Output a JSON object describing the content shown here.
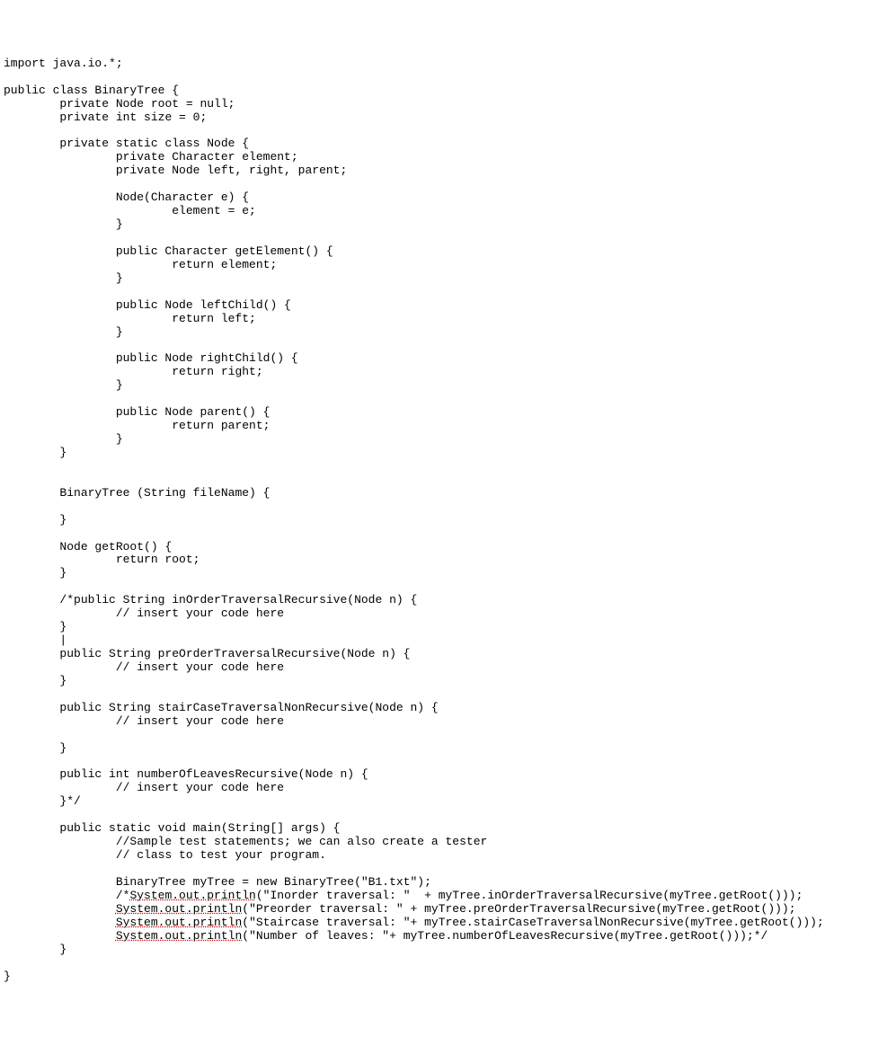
{
  "code_lines": [
    {
      "indent": 0,
      "segments": [
        {
          "t": "import java.io.*;"
        }
      ]
    },
    {
      "indent": 0,
      "segments": [
        {
          "t": ""
        }
      ]
    },
    {
      "indent": 0,
      "segments": [
        {
          "t": "public class BinaryTree {"
        }
      ]
    },
    {
      "indent": 8,
      "segments": [
        {
          "t": "private Node root = null;"
        }
      ]
    },
    {
      "indent": 8,
      "segments": [
        {
          "t": "private int size = 0;"
        }
      ]
    },
    {
      "indent": 0,
      "segments": [
        {
          "t": ""
        }
      ]
    },
    {
      "indent": 8,
      "segments": [
        {
          "t": "private static class Node {"
        }
      ]
    },
    {
      "indent": 16,
      "segments": [
        {
          "t": "private Character element;"
        }
      ]
    },
    {
      "indent": 16,
      "segments": [
        {
          "t": "private Node left, right, parent;"
        }
      ]
    },
    {
      "indent": 0,
      "segments": [
        {
          "t": ""
        }
      ]
    },
    {
      "indent": 16,
      "segments": [
        {
          "t": "Node(Character e) {"
        }
      ]
    },
    {
      "indent": 24,
      "segments": [
        {
          "t": "element = e;"
        }
      ]
    },
    {
      "indent": 16,
      "segments": [
        {
          "t": "}"
        }
      ]
    },
    {
      "indent": 0,
      "segments": [
        {
          "t": ""
        }
      ]
    },
    {
      "indent": 16,
      "segments": [
        {
          "t": "public Character getElement() {"
        }
      ]
    },
    {
      "indent": 24,
      "segments": [
        {
          "t": "return element;"
        }
      ]
    },
    {
      "indent": 16,
      "segments": [
        {
          "t": "}"
        }
      ]
    },
    {
      "indent": 0,
      "segments": [
        {
          "t": ""
        }
      ]
    },
    {
      "indent": 16,
      "segments": [
        {
          "t": "public Node leftChild() {"
        }
      ]
    },
    {
      "indent": 24,
      "segments": [
        {
          "t": "return left;"
        }
      ]
    },
    {
      "indent": 16,
      "segments": [
        {
          "t": "}"
        }
      ]
    },
    {
      "indent": 0,
      "segments": [
        {
          "t": ""
        }
      ]
    },
    {
      "indent": 16,
      "segments": [
        {
          "t": "public Node rightChild() {"
        }
      ]
    },
    {
      "indent": 24,
      "segments": [
        {
          "t": "return right;"
        }
      ]
    },
    {
      "indent": 16,
      "segments": [
        {
          "t": "}"
        }
      ]
    },
    {
      "indent": 0,
      "segments": [
        {
          "t": ""
        }
      ]
    },
    {
      "indent": 16,
      "segments": [
        {
          "t": "public Node parent() {"
        }
      ]
    },
    {
      "indent": 24,
      "segments": [
        {
          "t": "return parent;"
        }
      ]
    },
    {
      "indent": 16,
      "segments": [
        {
          "t": "}"
        }
      ]
    },
    {
      "indent": 8,
      "segments": [
        {
          "t": "}"
        }
      ]
    },
    {
      "indent": 0,
      "segments": [
        {
          "t": ""
        }
      ]
    },
    {
      "indent": 0,
      "segments": [
        {
          "t": ""
        }
      ]
    },
    {
      "indent": 8,
      "segments": [
        {
          "t": "BinaryTree (String fileName) {"
        }
      ]
    },
    {
      "indent": 0,
      "segments": [
        {
          "t": ""
        }
      ]
    },
    {
      "indent": 8,
      "segments": [
        {
          "t": "}"
        }
      ]
    },
    {
      "indent": 0,
      "segments": [
        {
          "t": ""
        }
      ]
    },
    {
      "indent": 8,
      "segments": [
        {
          "t": "Node getRoot() {"
        }
      ]
    },
    {
      "indent": 16,
      "segments": [
        {
          "t": "return root;"
        }
      ]
    },
    {
      "indent": 8,
      "segments": [
        {
          "t": "}"
        }
      ]
    },
    {
      "indent": 0,
      "segments": [
        {
          "t": ""
        }
      ]
    },
    {
      "indent": 8,
      "segments": [
        {
          "t": "/*public String inOrderTraversalRecursive(Node n) {"
        }
      ]
    },
    {
      "indent": 16,
      "segments": [
        {
          "t": "// insert your code here"
        }
      ]
    },
    {
      "indent": 8,
      "segments": [
        {
          "t": "}"
        }
      ]
    },
    {
      "indent": 8,
      "segments": [
        {
          "t": "|"
        }
      ]
    },
    {
      "indent": 8,
      "segments": [
        {
          "t": "public String preOrderTraversalRecursive(Node n) {"
        }
      ]
    },
    {
      "indent": 16,
      "segments": [
        {
          "t": "// insert your code here"
        }
      ]
    },
    {
      "indent": 8,
      "segments": [
        {
          "t": "}"
        }
      ]
    },
    {
      "indent": 0,
      "segments": [
        {
          "t": ""
        }
      ]
    },
    {
      "indent": 8,
      "segments": [
        {
          "t": "public String stairCaseTraversalNonRecursive(Node n) {"
        }
      ]
    },
    {
      "indent": 16,
      "segments": [
        {
          "t": "// insert your code here"
        }
      ]
    },
    {
      "indent": 0,
      "segments": [
        {
          "t": ""
        }
      ]
    },
    {
      "indent": 8,
      "segments": [
        {
          "t": "}"
        }
      ]
    },
    {
      "indent": 0,
      "segments": [
        {
          "t": ""
        }
      ]
    },
    {
      "indent": 8,
      "segments": [
        {
          "t": "public int numberOfLeavesRecursive(Node n) {"
        }
      ]
    },
    {
      "indent": 16,
      "segments": [
        {
          "t": "// insert your code here"
        }
      ]
    },
    {
      "indent": 8,
      "segments": [
        {
          "t": "}*/"
        }
      ]
    },
    {
      "indent": 0,
      "segments": [
        {
          "t": ""
        }
      ]
    },
    {
      "indent": 8,
      "segments": [
        {
          "t": "public static void main(String[] args) {"
        }
      ]
    },
    {
      "indent": 16,
      "segments": [
        {
          "t": "//Sample test statements; we can also create a tester"
        }
      ]
    },
    {
      "indent": 16,
      "segments": [
        {
          "t": "// class to test your program."
        }
      ]
    },
    {
      "indent": 0,
      "segments": [
        {
          "t": ""
        }
      ]
    },
    {
      "indent": 16,
      "segments": [
        {
          "t": "BinaryTree myTree = new BinaryTree(\"B1.txt\");"
        }
      ]
    },
    {
      "indent": 16,
      "segments": [
        {
          "t": "/*"
        },
        {
          "t": "System.out.println",
          "u": true
        },
        {
          "t": "(\"Inorder traversal: \"  + myTree.inOrderTraversalRecursive(myTree.getRoot()));"
        }
      ]
    },
    {
      "indent": 16,
      "segments": [
        {
          "t": "System.out.println",
          "u": true
        },
        {
          "t": "(\"Preorder traversal: \" + myTree.preOrderTraversalRecursive(myTree.getRoot()));"
        }
      ]
    },
    {
      "indent": 16,
      "segments": [
        {
          "t": "System.out.println",
          "u": true
        },
        {
          "t": "(\"Staircase traversal: \"+ myTree.stairCaseTraversalNonRecursive(myTree.getRoot()));"
        }
      ]
    },
    {
      "indent": 16,
      "segments": [
        {
          "t": "System.out.println",
          "u": true
        },
        {
          "t": "(\"Number of leaves: \"+ myTree.numberOfLeavesRecursive(myTree.getRoot()));*/"
        }
      ]
    },
    {
      "indent": 8,
      "segments": [
        {
          "t": "}"
        }
      ]
    },
    {
      "indent": 0,
      "segments": [
        {
          "t": ""
        }
      ]
    },
    {
      "indent": 0,
      "segments": [
        {
          "t": "}"
        }
      ]
    }
  ]
}
